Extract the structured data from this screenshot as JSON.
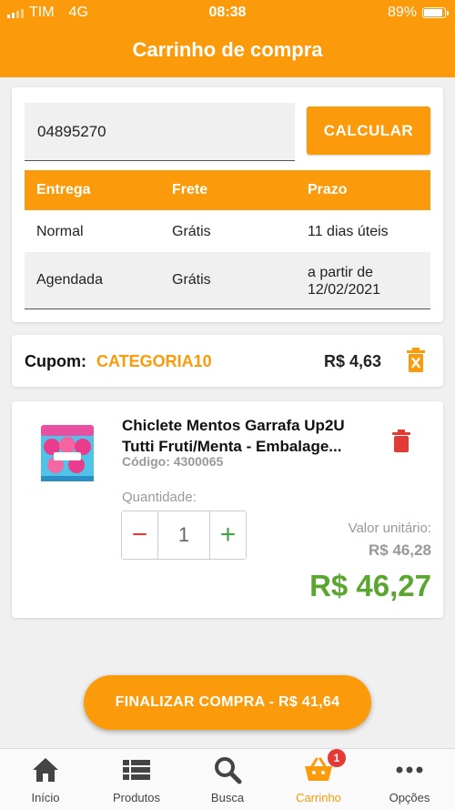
{
  "status_bar": {
    "carrier": "TIM",
    "network": "4G",
    "time": "08:38",
    "battery": "89%",
    "battery_level": 0.89
  },
  "header": {
    "title": "Carrinho de compra"
  },
  "shipping": {
    "cep_value": "04895270",
    "calculate_label": "CALCULAR",
    "columns": [
      "Entrega",
      "Frete",
      "Prazo"
    ],
    "rows": [
      {
        "entrega": "Normal",
        "frete": "Grátis",
        "prazo": "11 dias úteis"
      },
      {
        "entrega": "Agendada",
        "frete": "Grátis",
        "prazo": "a partir de 12/02/2021"
      }
    ]
  },
  "coupon": {
    "label": "Cupom:",
    "code": "CATEGORIA10",
    "value": "R$ 4,63",
    "remove_icon": "trash-icon"
  },
  "product": {
    "name": "Chiclete Mentos Garrafa Up2U Tutti Fruti/Menta - Embalage...",
    "code": "Código: 4300065",
    "quantity_label": "Quantidade:",
    "quantity": "1",
    "minus": "−",
    "plus": "+",
    "unit_label": "Valor unitário:",
    "unit_price": "R$ 46,28",
    "total": "R$ 46,27",
    "delete_icon": "trash-icon"
  },
  "checkout": {
    "finalize_label": "FINALIZAR COMPRA - R$ 41,64"
  },
  "tabs": [
    {
      "label": "Início",
      "icon": "home-icon"
    },
    {
      "label": "Produtos",
      "icon": "list-icon"
    },
    {
      "label": "Busca",
      "icon": "search-icon"
    },
    {
      "label": "Carrinho",
      "icon": "basket-icon",
      "badge": "1"
    },
    {
      "label": "Opções",
      "icon": "more-icon"
    }
  ],
  "colors": {
    "brand": "#fb9a0a",
    "price_green": "#5aa631",
    "delete_red": "#e53935"
  }
}
